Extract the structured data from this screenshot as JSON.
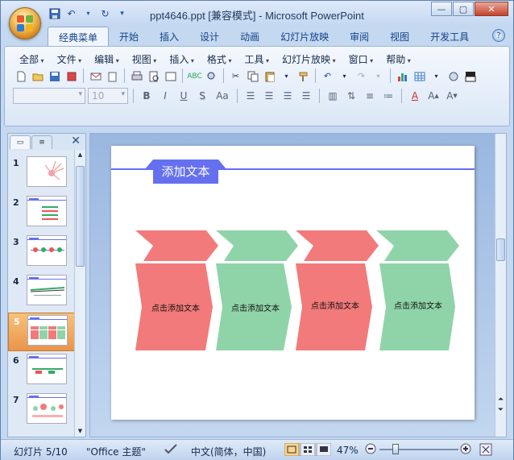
{
  "window": {
    "title": "ppt4646.ppt [兼容模式] - Microsoft PowerPoint",
    "controls": {
      "minimize": "—",
      "maximize": "▢",
      "close": "✕"
    }
  },
  "quick_access": [
    "save-icon",
    "undo-icon",
    "redo-icon",
    "customize-icon"
  ],
  "ribbon_tabs": [
    "经典菜单",
    "开始",
    "插入",
    "设计",
    "动画",
    "幻灯片放映",
    "审阅",
    "视图",
    "开发工具"
  ],
  "active_tab": "经典菜单",
  "classic_menu": [
    "全部",
    "文件",
    "编辑",
    "视图",
    "插入",
    "格式",
    "工具",
    "幻灯片放映",
    "窗口",
    "帮助"
  ],
  "format_bar": {
    "font_name": "",
    "font_size": "10",
    "buttons": [
      "B",
      "I",
      "U",
      "S",
      "Aa"
    ]
  },
  "left_pane": {
    "tabs": [
      "slides-tab",
      "outline-tab"
    ],
    "close": "✕",
    "slides": [
      {
        "num": "1"
      },
      {
        "num": "2"
      },
      {
        "num": "3"
      },
      {
        "num": "4"
      },
      {
        "num": "5",
        "selected": true
      },
      {
        "num": "6"
      },
      {
        "num": "7"
      }
    ]
  },
  "slide": {
    "title": "添加文本",
    "boxes": [
      "点击添加文本",
      "点击添加文本",
      "点击添加文本",
      "点击添加文本"
    ],
    "colors": {
      "accent": "#6470f0",
      "red": "#f27a7a",
      "green": "#8fd4a8"
    }
  },
  "status": {
    "slide_info": "幻灯片 5/10",
    "theme": "\"Office 主题\"",
    "language": "中文(简体，中国)",
    "zoom": "47%"
  }
}
